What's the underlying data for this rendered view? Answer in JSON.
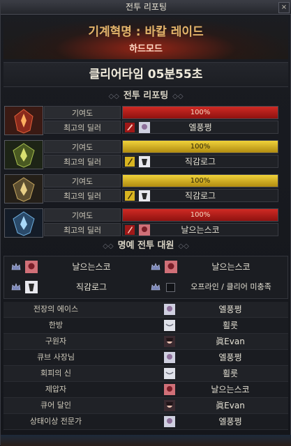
{
  "window": {
    "title": "전투 리포팅",
    "close_label": "×"
  },
  "raid": {
    "name": "기계혁명 : 바칼 레이드",
    "mode": "하드모드"
  },
  "clear_time": "클리어타임  05분55초",
  "report": {
    "section_title": "전투 리포팅",
    "contribution_label": "기여도",
    "best_dealer_label": "최고의 딜러",
    "rows": [
      {
        "portrait": "red-dragon-portrait",
        "bar_color": "red",
        "percent": "100%",
        "dealer": "엘풍쩡",
        "class_icon": "red-class-icon"
      },
      {
        "portrait": "green-dragon-portrait",
        "bar_color": "gold",
        "percent": "100%",
        "dealer": "직감로그",
        "class_icon": "gold-class-icon"
      },
      {
        "portrait": "bronze-dragon-portrait",
        "bar_color": "gold",
        "percent": "100%",
        "dealer": "직감로그",
        "class_icon": "gold-class-icon"
      },
      {
        "portrait": "blue-dragon-portrait",
        "bar_color": "red",
        "percent": "100%",
        "dealer": "날으는스코",
        "class_icon": "red-class-icon"
      }
    ]
  },
  "honor": {
    "section_title": "명예 전투 대원",
    "members": [
      "날으는스코",
      "날으는스코",
      "직감로그",
      "오프라인 / 클리어 미충족"
    ]
  },
  "awards": [
    {
      "title": "전장의 에이스",
      "name": "엘풍쩡"
    },
    {
      "title": "한방",
      "name": "횔룻"
    },
    {
      "title": "구원자",
      "name": "眞Evan"
    },
    {
      "title": "큐브 사장님",
      "name": "엘풍쩡"
    },
    {
      "title": "회피의 신",
      "name": "횔룻"
    },
    {
      "title": "제압자",
      "name": "날으는스코"
    },
    {
      "title": "큐어 달인",
      "name": "眞Evan"
    },
    {
      "title": "상태이상 전문가",
      "name": "엘풍쩡"
    }
  ],
  "colors": {
    "red_bar": "#c0231e",
    "gold_bar": "#e2c02c",
    "title_gold": "#e2b36a"
  }
}
